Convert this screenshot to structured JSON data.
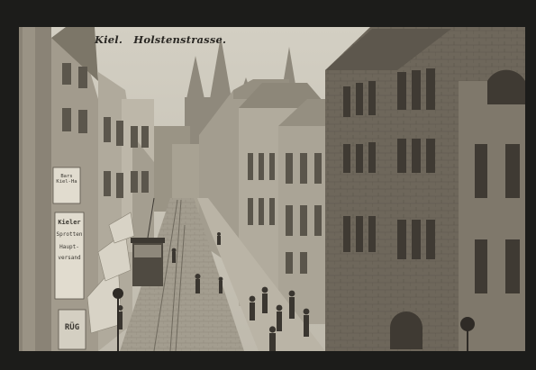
{
  "caption": {
    "city": "Kiel.",
    "street": "Holstenstrasse."
  },
  "signs": {
    "sign_bars": "Bars Kiel-Ha",
    "sign_kieler": "Kieler",
    "sign_sprotten": "Sprotten",
    "sign_haupt": "Haupt-",
    "sign_versand": "versand",
    "sign_bottom": "RÜG"
  },
  "colors": {
    "border": "#1c1c1a",
    "sky": "#cdc9bd",
    "stone": "#8e877a",
    "dark": "#3a3630"
  }
}
